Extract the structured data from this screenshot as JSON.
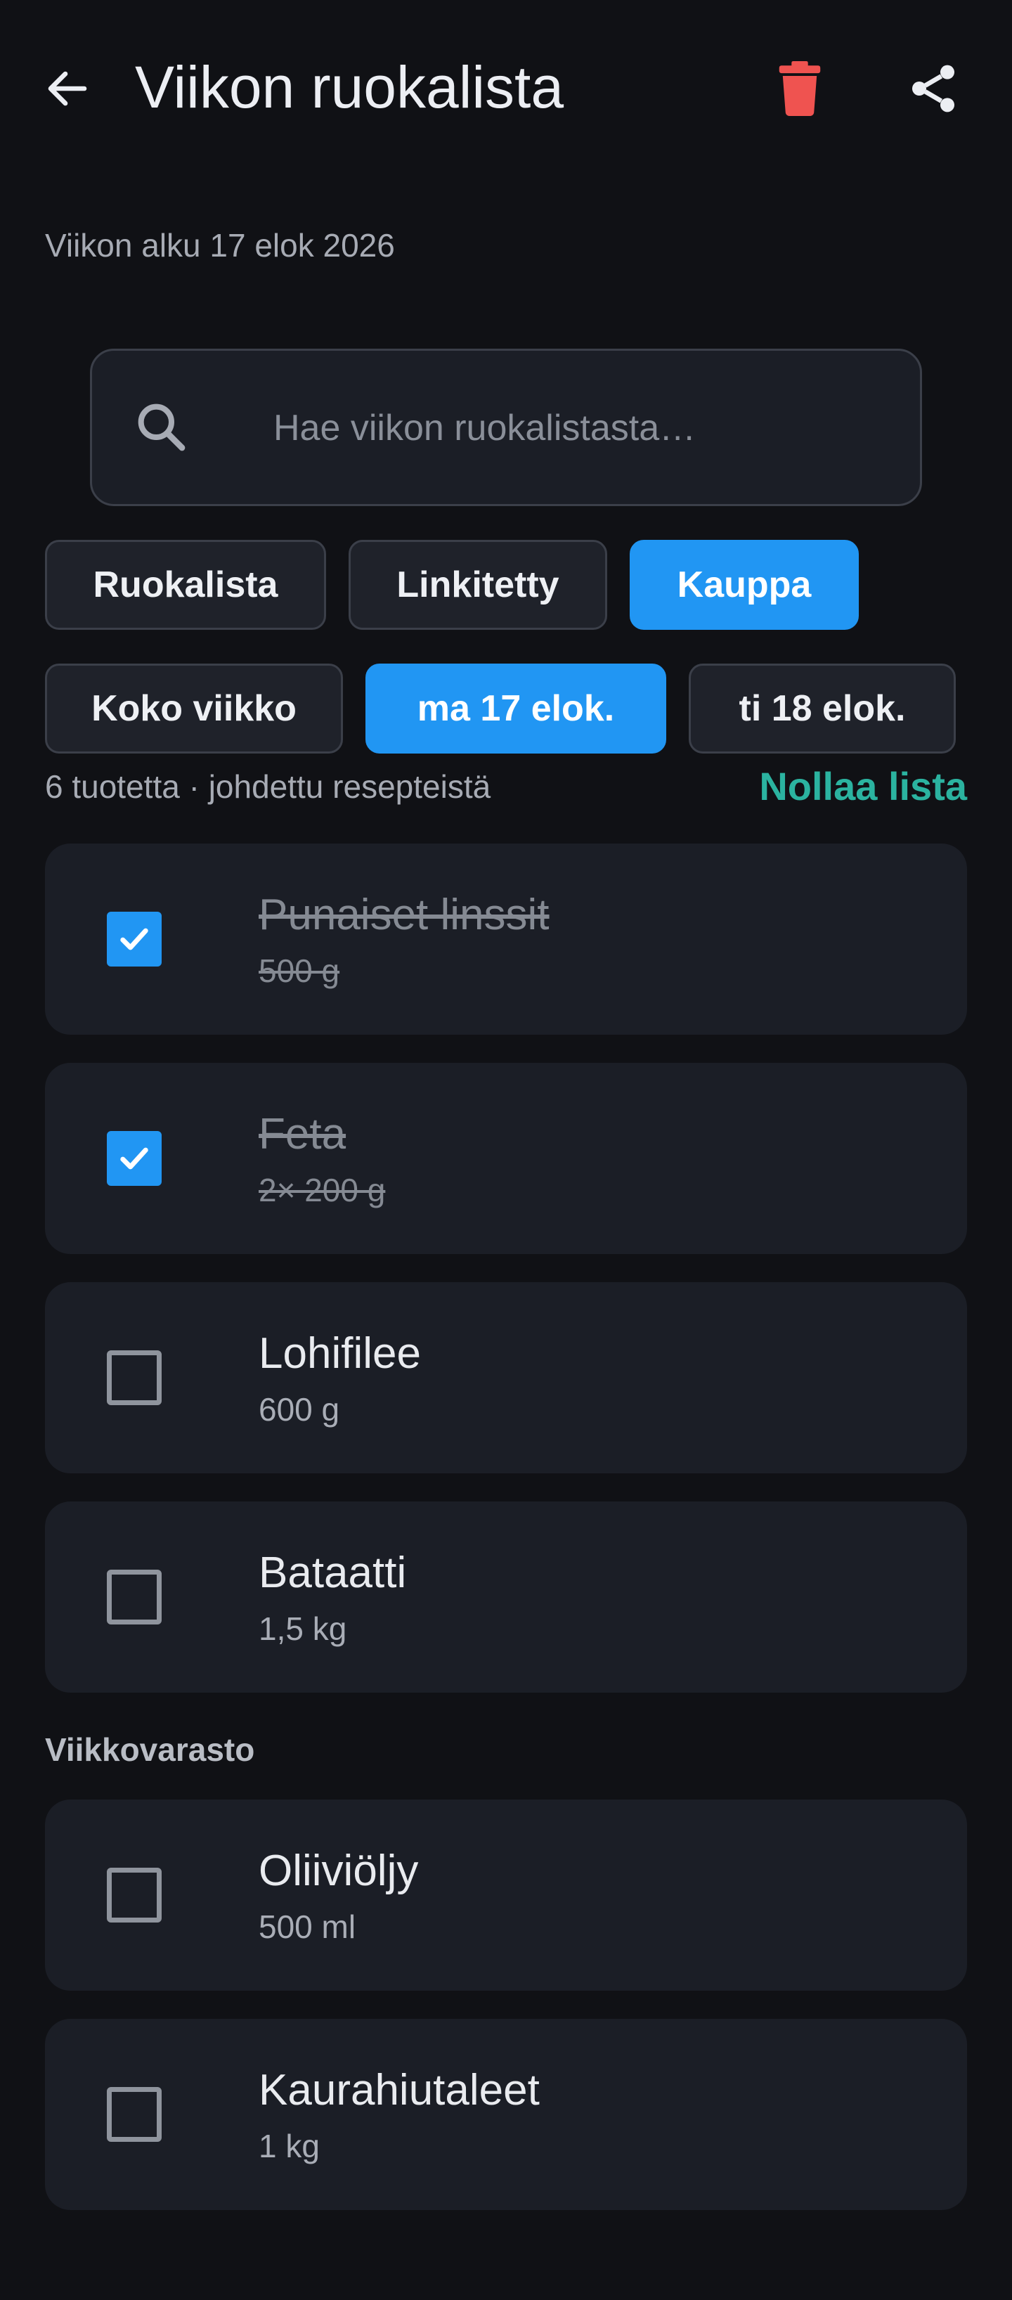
{
  "header": {
    "title": "Viikon ruokalista",
    "back_icon": "arrow-left-icon",
    "delete_icon": "trash-icon",
    "share_icon": "share-icon",
    "delete_color": "#ef5350"
  },
  "week_start": "Viikon alku 17 elok 2026",
  "search": {
    "placeholder": "Hae viikon ruokalistasta…",
    "value": "",
    "icon": "search-icon"
  },
  "view_tabs": [
    {
      "label": "Ruokalista",
      "active": false
    },
    {
      "label": "Linkitetty",
      "active": false
    },
    {
      "label": "Kauppa",
      "active": true
    }
  ],
  "day_chips": [
    {
      "label": "Koko viikko",
      "active": false
    },
    {
      "label": "ma 17 elok.",
      "active": true
    },
    {
      "label": "ti 18 elok.",
      "active": false
    }
  ],
  "summary": {
    "text": "6 tuotetta · johdettu resepteistä",
    "reset_label": "Nollaa lista"
  },
  "items": [
    {
      "name": "Punaiset linssit",
      "qty": "500 g",
      "checked": true
    },
    {
      "name": "Feta",
      "qty": "2× 200 g",
      "checked": true
    },
    {
      "name": "Lohifilee",
      "qty": "600 g",
      "checked": false
    },
    {
      "name": "Bataatti",
      "qty": "1,5 kg",
      "checked": false
    }
  ],
  "pantry": {
    "label": "Viikkovarasto",
    "items": [
      {
        "name": "Oliiviöljy",
        "qty": "500 ml",
        "checked": false
      },
      {
        "name": "Kaurahiutaleet",
        "qty": "1 kg",
        "checked": false
      }
    ]
  },
  "colors": {
    "accent": "#2196f3",
    "link": "#2bb3a0",
    "background": "#101115",
    "card": "#1b1e26"
  }
}
